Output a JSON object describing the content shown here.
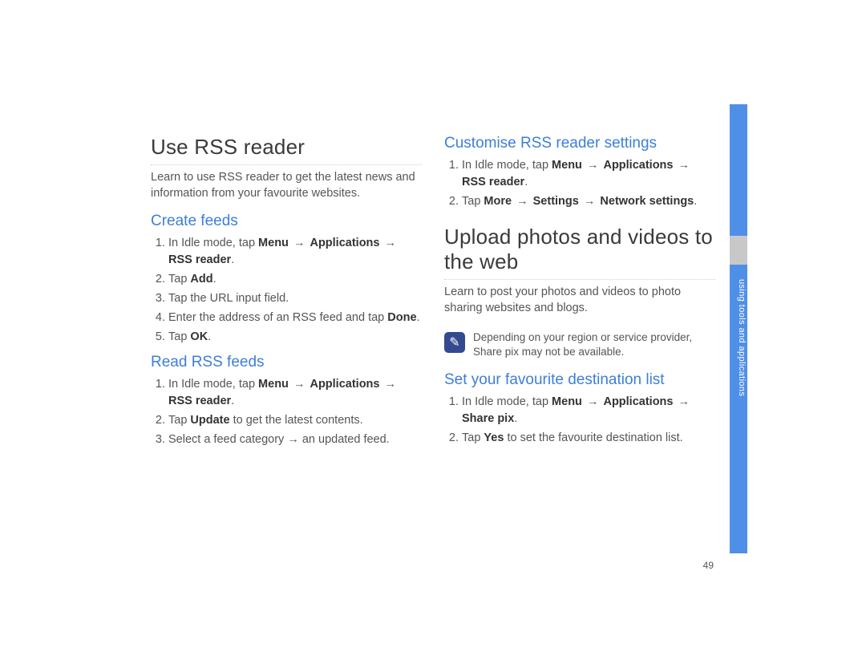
{
  "page_number": "49",
  "side_tab_label": "using tools and applications",
  "arrow_glyph": "→",
  "note_icon_glyph": "✎",
  "left": {
    "h1": "Use RSS reader",
    "intro": "Learn to use RSS reader to get the latest news and information from your favourite websites.",
    "sub1": "Create feeds",
    "s1_1a": "In Idle mode, tap ",
    "s1_1b": "Menu",
    "s1_1c": "Applications",
    "s1_1d": "RSS reader",
    "s1_2a": "Tap ",
    "s1_2b": "Add",
    "s1_3": "Tap the URL input field.",
    "s1_4a": "Enter the address of an RSS feed and tap ",
    "s1_4b": "Done",
    "s1_5a": "Tap ",
    "s1_5b": "OK",
    "sub2": "Read RSS feeds",
    "s2_1a": "In Idle mode, tap ",
    "s2_1b": "Menu",
    "s2_1c": "Applications",
    "s2_1d": "RSS reader",
    "s2_2a": "Tap ",
    "s2_2b": "Update",
    "s2_2c": " to get the latest contents.",
    "s2_3": "Select a feed category → an updated feed."
  },
  "right": {
    "sub1": "Customise RSS reader settings",
    "c1_1a": "In Idle mode, tap ",
    "c1_1b": "Menu",
    "c1_1c": "Applications",
    "c1_1d": "RSS reader",
    "c1_2a": "Tap ",
    "c1_2b": "More",
    "c1_2c": "Settings",
    "c1_2d": "Network settings",
    "h1": "Upload photos and videos to the web",
    "intro": "Learn to post your photos and videos to photo sharing websites and blogs.",
    "note": "Depending on your region or service provider, Share pix may not be available.",
    "sub2": "Set your favourite destination list",
    "d1_1a": "In Idle mode, tap ",
    "d1_1b": "Menu",
    "d1_1c": "Applications",
    "d1_1d": "Share pix",
    "d1_2a": "Tap ",
    "d1_2b": "Yes",
    "d1_2c": " to set the favourite destination list."
  }
}
